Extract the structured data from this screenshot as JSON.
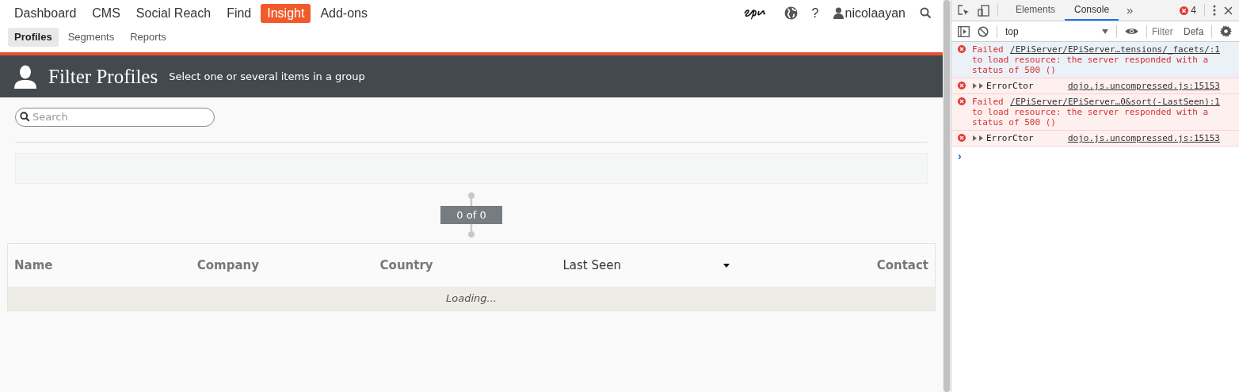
{
  "nav": {
    "items": [
      {
        "label": "Dashboard",
        "selected": false
      },
      {
        "label": "CMS",
        "selected": false
      },
      {
        "label": "Social Reach",
        "selected": false
      },
      {
        "label": "Find",
        "selected": false
      },
      {
        "label": "Insight",
        "selected": true
      },
      {
        "label": "Add-ons",
        "selected": false
      }
    ],
    "help": "?",
    "user": "nicolaayan"
  },
  "subnav": {
    "items": [
      {
        "label": "Profiles",
        "selected": true
      },
      {
        "label": "Segments",
        "selected": false
      },
      {
        "label": "Reports",
        "selected": false
      }
    ]
  },
  "header": {
    "title": "Filter Profiles",
    "subtitle": "Select one or several items in a group"
  },
  "search": {
    "placeholder": "Search"
  },
  "pager": "0 of 0",
  "table": {
    "columns": [
      {
        "label": "Name",
        "sorted": false
      },
      {
        "label": "Company",
        "sorted": false
      },
      {
        "label": "Country",
        "sorted": false
      },
      {
        "label": "Last Seen",
        "sorted": true
      },
      {
        "label": "Contact",
        "sorted": false
      }
    ],
    "status": "Loading..."
  },
  "devtools": {
    "tabs": [
      {
        "label": "Elements",
        "selected": false
      },
      {
        "label": "Console",
        "selected": true
      }
    ],
    "more": "»",
    "error_count": "4",
    "context": "top",
    "filter": {
      "placeholder": "Filter"
    },
    "levels": "Defa",
    "messages": [
      {
        "kind": "network",
        "selected": true,
        "text": "Failed",
        "source": "/EPiServer/EPiServer…tensions/_facets/:1",
        "detail": "to load resource: the server responded with a status of 500 ()"
      },
      {
        "kind": "object",
        "selected": false,
        "text": "ErrorCtor",
        "source": "dojo.js.uncompressed.js:15153"
      },
      {
        "kind": "network",
        "selected": false,
        "text": "Failed",
        "source": "/EPiServer/EPiServer…0&sort(-LastSeen):1",
        "detail": "to load resource: the server responded with a status of 500 ()"
      },
      {
        "kind": "object",
        "selected": false,
        "text": "ErrorCtor",
        "source": "dojo.js.uncompressed.js:15153"
      }
    ],
    "prompt": "›"
  }
}
